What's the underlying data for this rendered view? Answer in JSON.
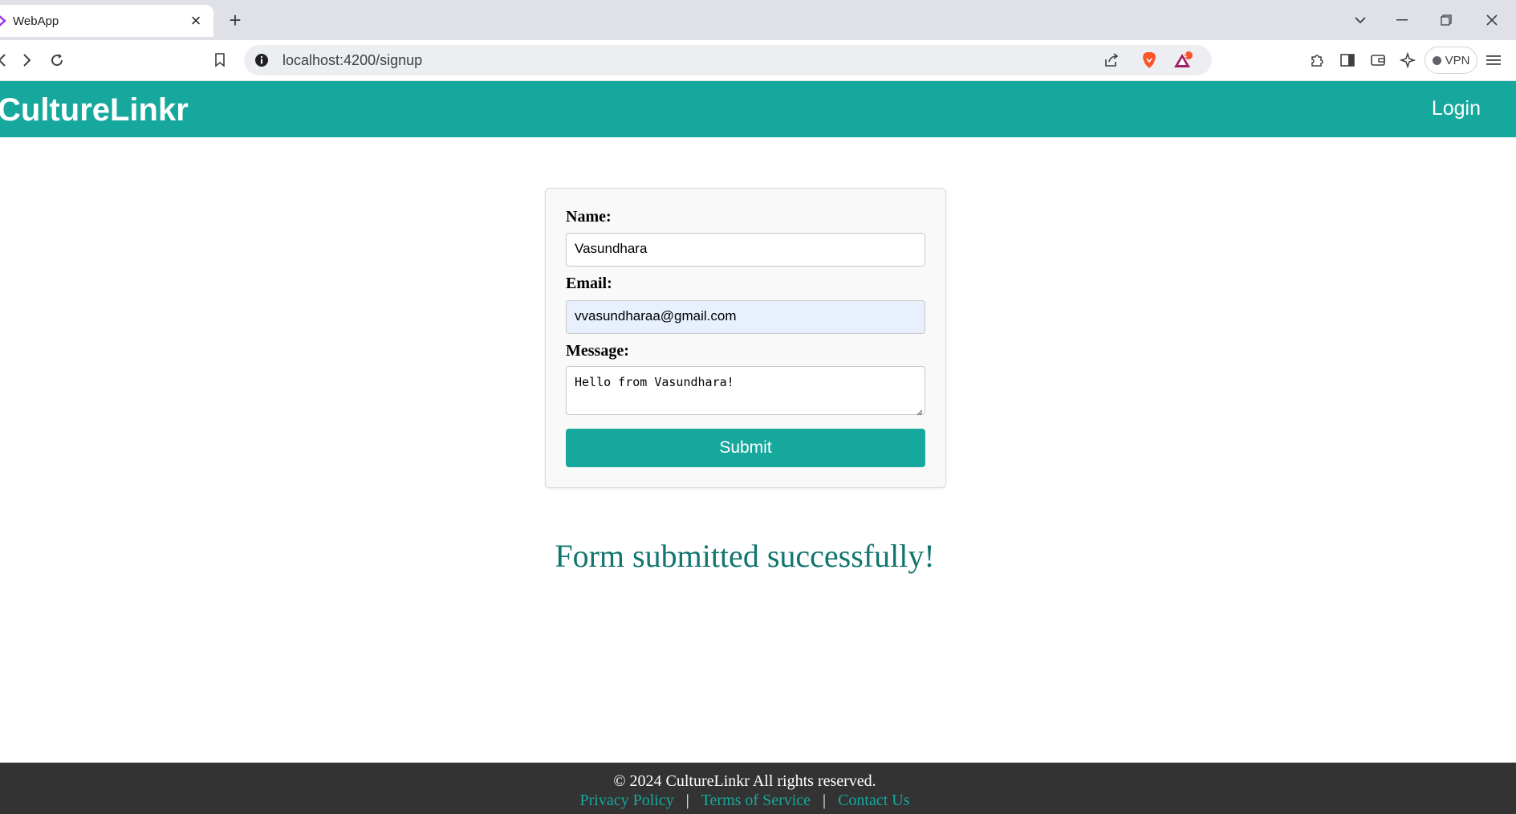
{
  "browser": {
    "tab_title": "WebApp",
    "tab_close": "×",
    "new_tab": "+",
    "url": "localhost:4200/signup",
    "brave_badge_count": "1",
    "vpn_label": "VPN",
    "icons": [
      "back-icon",
      "forward-icon",
      "reload-icon",
      "bookmark-icon",
      "site-info-icon",
      "share-icon",
      "brave-shield-icon",
      "brave-rewards-icon",
      "extensions-icon",
      "sidebar-icon",
      "wallet-icon",
      "leo-ai-icon",
      "menu-icon",
      "tab-list-chevron-icon",
      "minimize-icon",
      "restore-icon",
      "close-window-icon"
    ]
  },
  "header": {
    "brand": "CultureLinkr",
    "login_label": "Login",
    "accent_color": "#17a89d"
  },
  "form": {
    "name_label": "Name:",
    "name_value": "Vasundhara",
    "email_label": "Email:",
    "email_value": "vvasundharaa@gmail.com",
    "message_label": "Message:",
    "message_value": "Hello from Vasundhara!",
    "submit_label": "Submit"
  },
  "success_message": "Form submitted successfully!",
  "footer": {
    "copyright": "© 2024 CultureLinkr All rights reserved.",
    "links": [
      "Privacy Policy",
      "Terms of Service",
      "Contact Us"
    ],
    "separator": "|"
  }
}
